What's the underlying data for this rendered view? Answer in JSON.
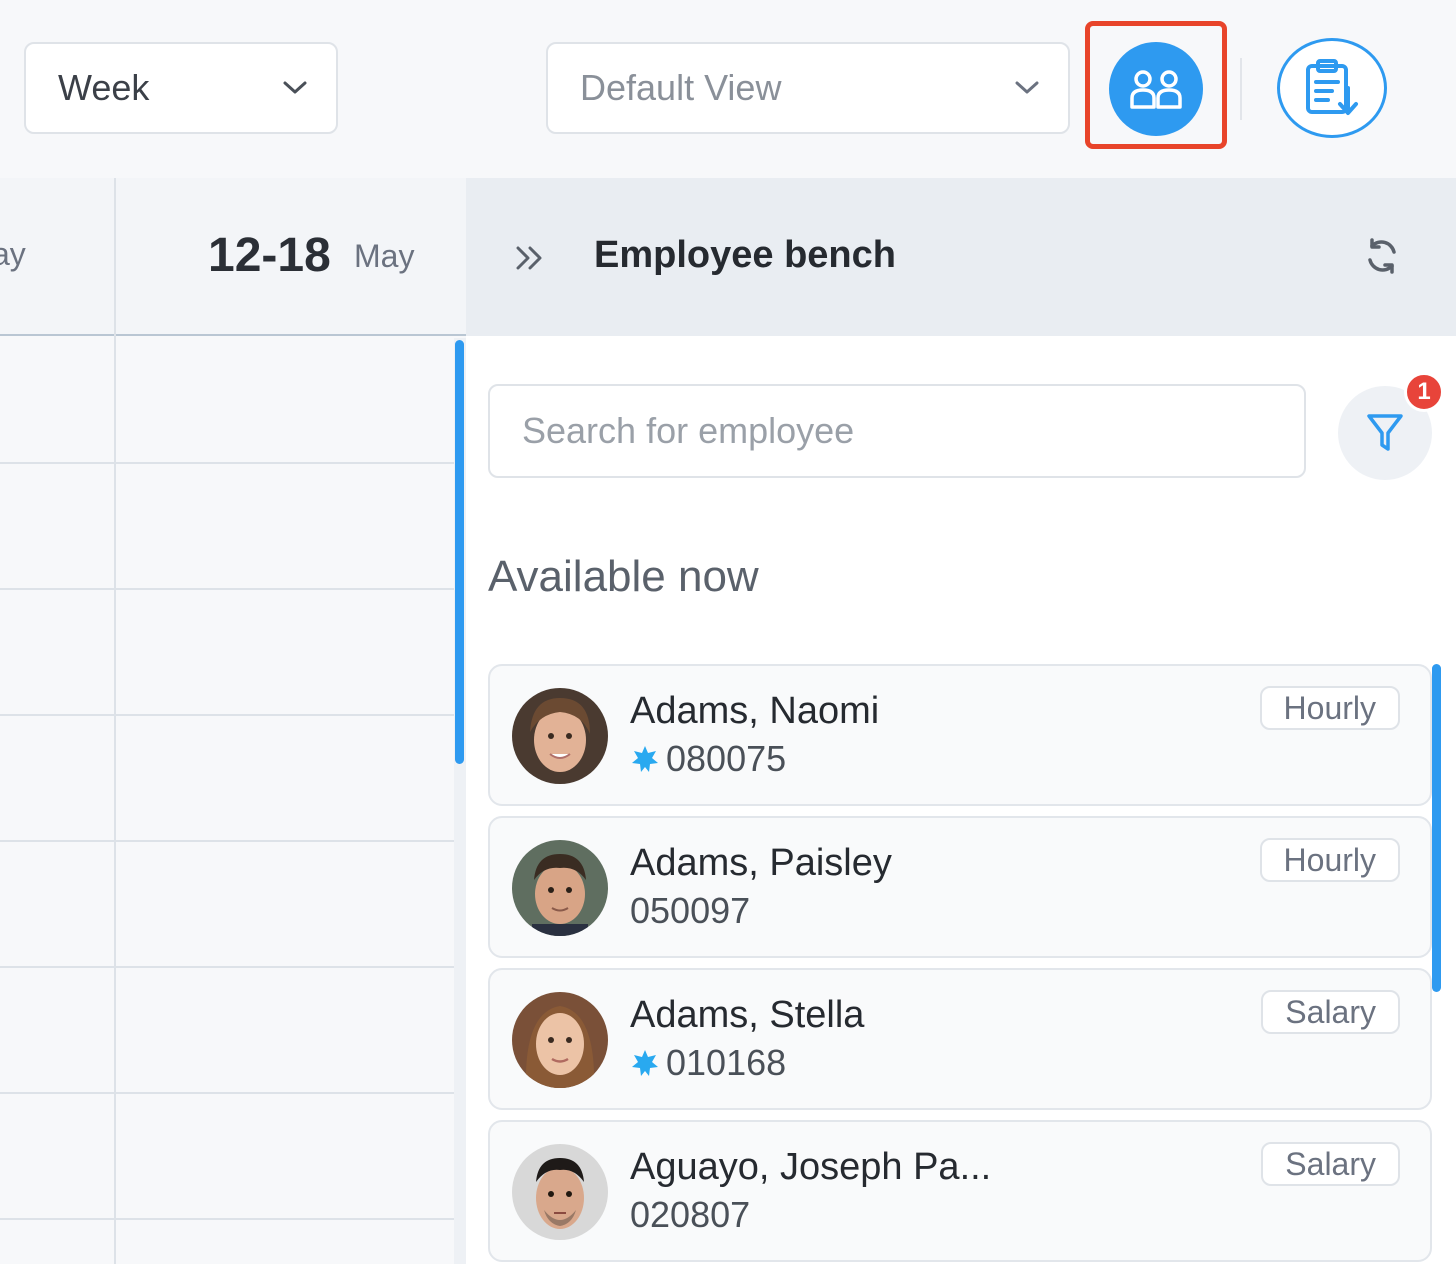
{
  "toolbar": {
    "period_select": {
      "value": "Week",
      "icon": "chevron-down-icon"
    },
    "view_select": {
      "value": "Default View",
      "icon": "chevron-down-icon"
    },
    "bench_toggle": {
      "icon": "people-icon",
      "active": true,
      "highlight_color": "#e8442a"
    },
    "export_button": {
      "icon": "clipboard-download-icon"
    }
  },
  "calendar": {
    "prev_day_label": "ay",
    "week_range": "12-18",
    "week_month": "May"
  },
  "bench": {
    "title": "Employee bench",
    "collapse_icon": "double-chevron-right-icon",
    "refresh_icon": "refresh-icon",
    "search": {
      "placeholder": "Search for employee",
      "value": ""
    },
    "filter": {
      "icon": "filter-icon",
      "badge_count": "1"
    },
    "section_title": "Available now",
    "employees": [
      {
        "name": "Adams, Naomi",
        "id": "080075",
        "starred": true,
        "pay_type": "Hourly"
      },
      {
        "name": "Adams, Paisley",
        "id": "050097",
        "starred": false,
        "pay_type": "Hourly"
      },
      {
        "name": "Adams, Stella",
        "id": "010168",
        "starred": true,
        "pay_type": "Salary"
      },
      {
        "name": "Aguayo, Joseph Pa...",
        "id": "020807",
        "starred": false,
        "pay_type": "Salary"
      }
    ]
  },
  "colors": {
    "accent": "#2e9af0",
    "badge_red": "#e8443a",
    "star": "#29a9f0"
  }
}
